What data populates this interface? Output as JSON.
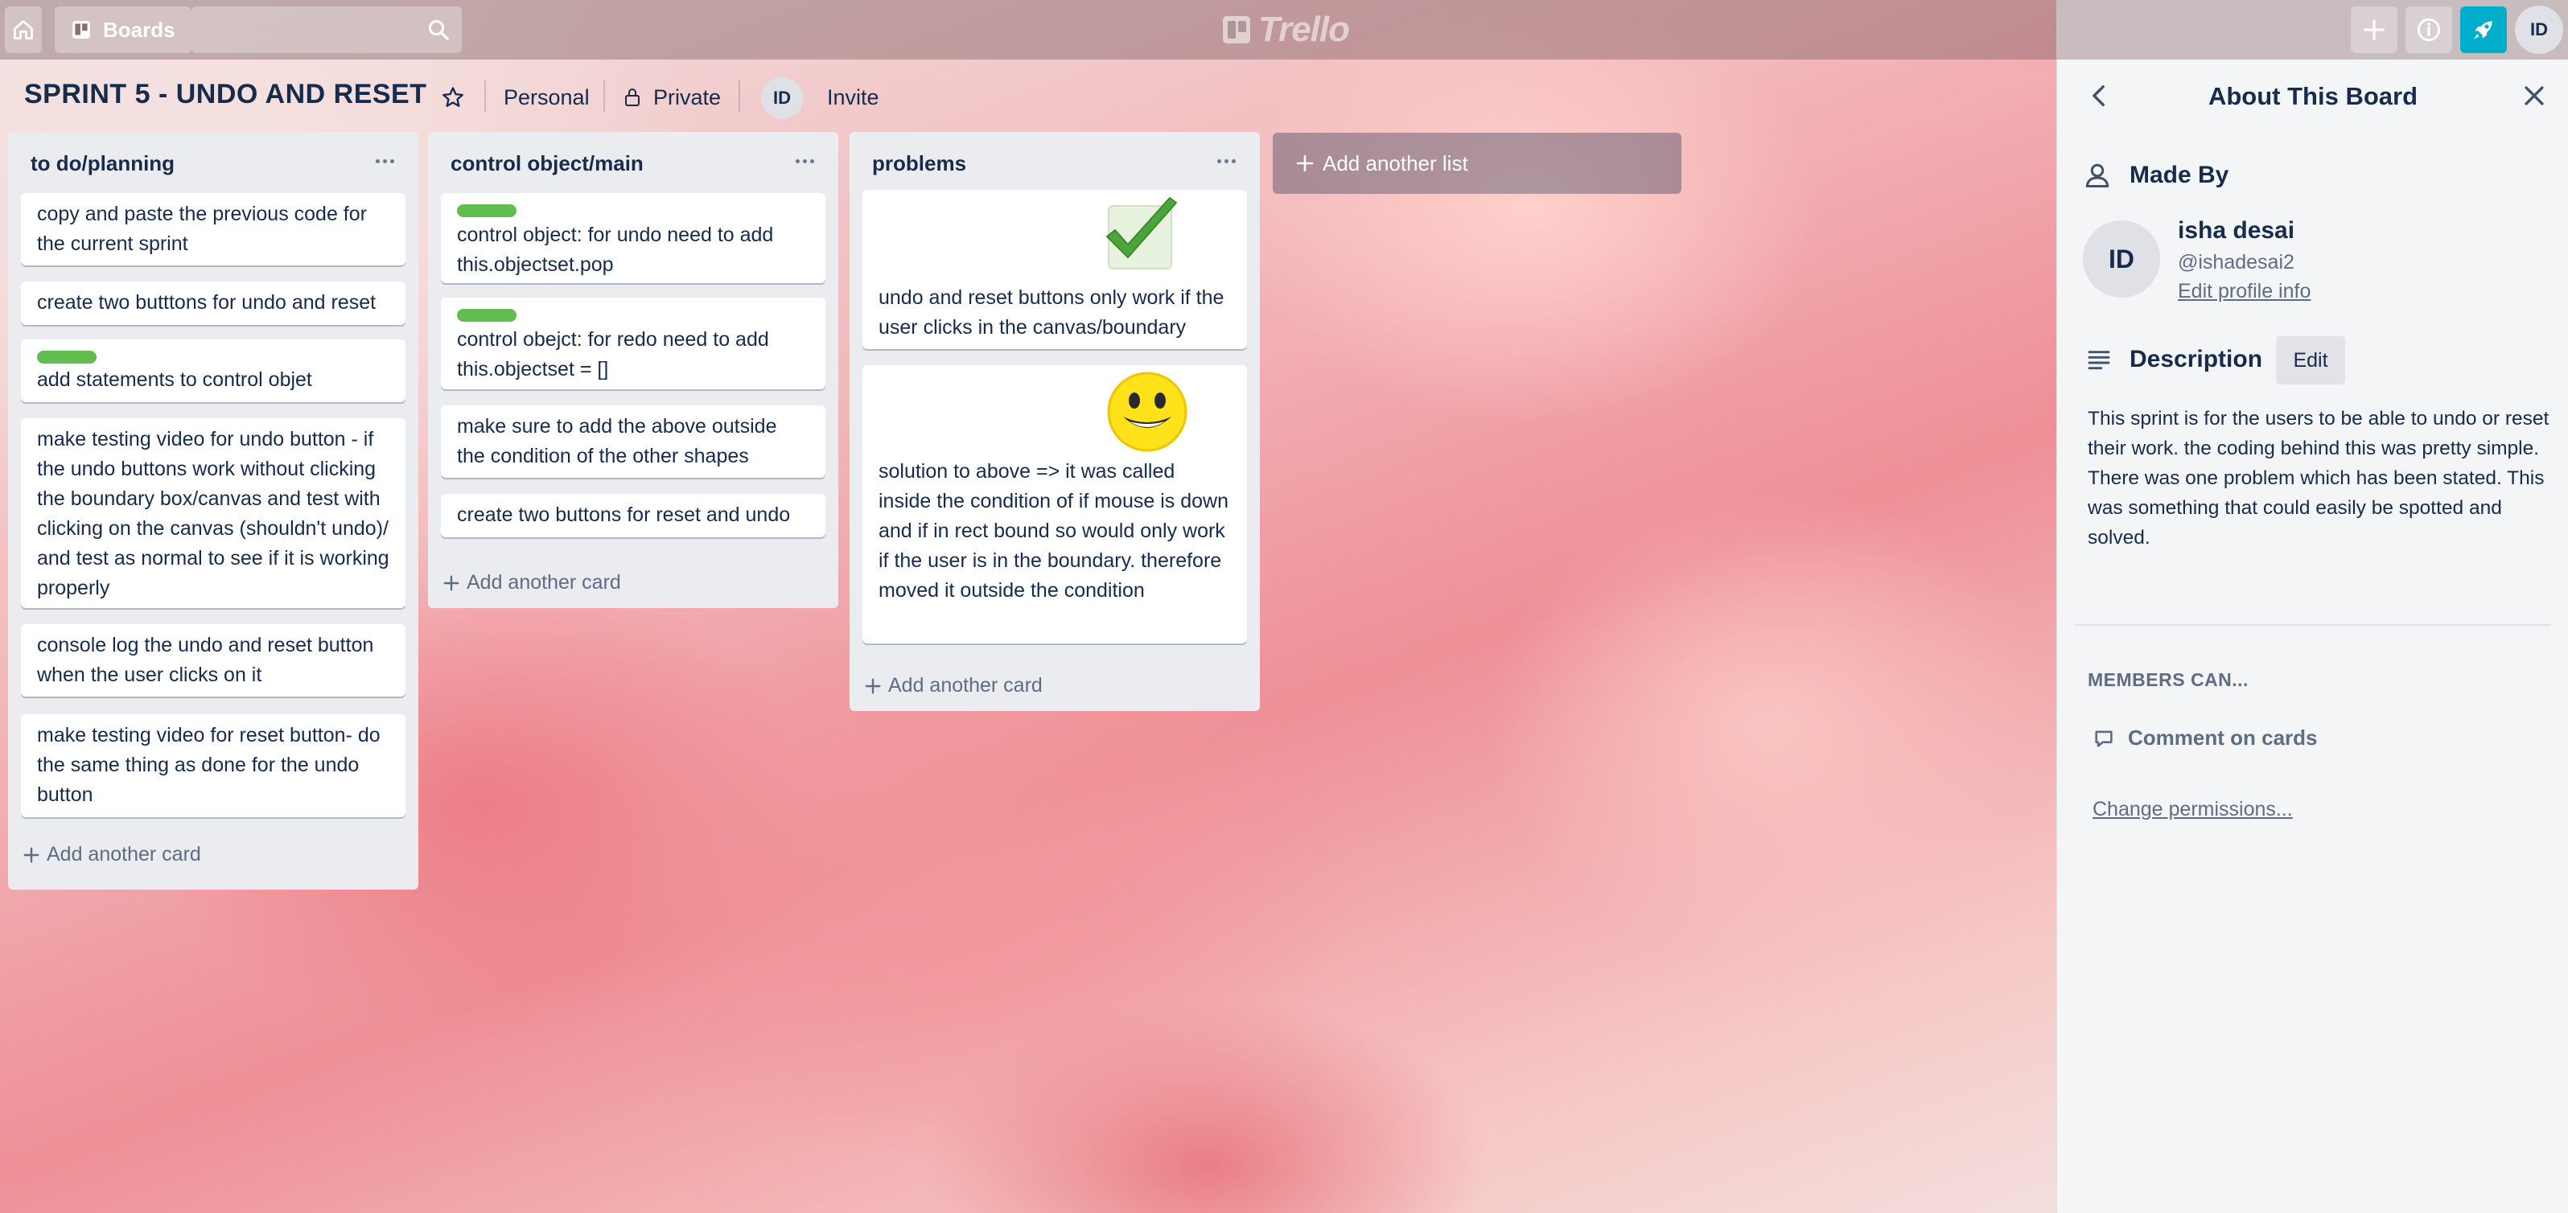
{
  "topbar": {
    "boards_label": "Boards",
    "logo_text": "Trello",
    "user_initials": "ID"
  },
  "board": {
    "title": "SPRINT 5 - UNDO AND RESET",
    "team": "Personal",
    "visibility": "Private",
    "member_initials": "ID",
    "invite_label": "Invite"
  },
  "lists": [
    {
      "title": "to do/planning",
      "cards": [
        "copy and paste the previous code for the current sprint",
        "create two butttons for undo and reset",
        "add statements to control objet",
        "make testing video for undo button - if the undo buttons work without clicking the boundary box/canvas and test with clicking on the canvas (shouldn't undo)/ and test as normal to see if it is working properly",
        "console log the undo and reset button when the user clicks on it",
        "make testing video for reset button- do the same thing as done for the undo button"
      ],
      "add_card": "Add another card"
    },
    {
      "title": "control object/main",
      "cards": [
        "control object: for undo need to add this.objectset.pop",
        "control obejct: for redo need to add this.objectset = []",
        "make sure to add the above outside the condition of the other shapes",
        "create two buttons for reset and undo"
      ],
      "add_card": "Add another card"
    },
    {
      "title": "problems",
      "cards": [
        "undo and reset buttons only work if the user clicks in the canvas/boundary",
        "solution to above => it was called inside the condition of if mouse is down and if in rect bound so would only work if the user is in the boundary. therefore moved it outside the condition"
      ],
      "add_card": "Add another card"
    }
  ],
  "add_list": "Add another list",
  "sidebar": {
    "title": "About This Board",
    "made_by": "Made By",
    "initials": "ID",
    "name": "isha desai",
    "handle": "@ishadesai2",
    "edit_profile": "Edit profile info",
    "description_heading": "Description",
    "edit_label": "Edit",
    "description": "This sprint is for the users to be able to undo or reset their work. the coding behind this was pretty simple. There was one problem which has been stated. This was something that could easily be spotted and solved.",
    "members_can": "MEMBERS CAN...",
    "comment": "Comment on cards",
    "change_permissions": "Change permissions..."
  },
  "colors": {
    "label_green": "#61bd4f",
    "accent_cyan": "#00aecc"
  }
}
